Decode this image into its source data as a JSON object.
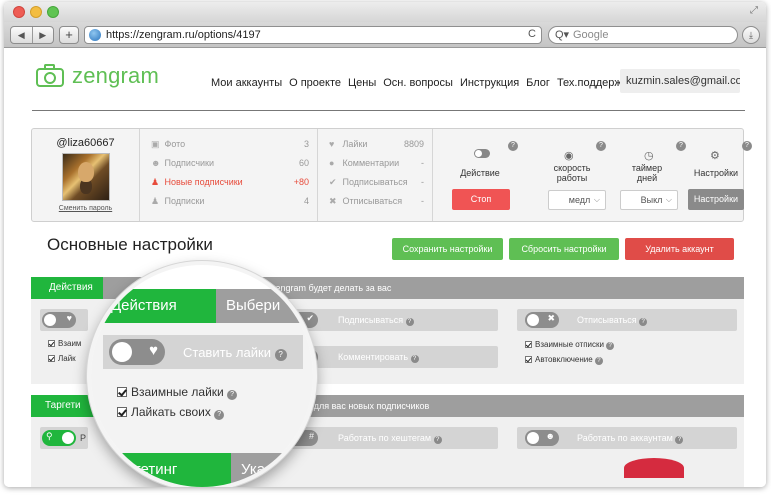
{
  "browser": {
    "url": "https://zengram.ru/options/4197",
    "search_placeholder": "Google",
    "nav_back": "◀",
    "nav_forward": "▶",
    "new_tab": "+",
    "reload": "C",
    "search_glyph": "Q▾",
    "download_glyph": "⤓",
    "fullscreen_glyph": "⤢"
  },
  "header": {
    "logo_text": "zengram",
    "nav": [
      "Мои аккаунты",
      "О проекте",
      "Цены",
      "Осн. вопросы",
      "Инструкция",
      "Блог",
      "Тех.поддержка"
    ],
    "email": "kuzmin.sales@gmail.com"
  },
  "account": {
    "username": "@liza60667",
    "change_password": "Сменить пароль"
  },
  "stats": {
    "col1": [
      {
        "icon": "▣",
        "label": "Фото",
        "value": "3"
      },
      {
        "icon": "☻",
        "label": "Подписчики",
        "value": "60"
      },
      {
        "icon": "♟",
        "label": "Новые подписчики",
        "value": "+80",
        "highlight": true
      },
      {
        "icon": "♟",
        "label": "Подписки",
        "value": "4"
      }
    ],
    "col2": [
      {
        "icon": "♥",
        "label": "Лайки",
        "value": "8809"
      },
      {
        "icon": "●",
        "label": "Комментарии",
        "value": "-"
      },
      {
        "icon": "✔",
        "label": "Подписываться",
        "value": "-"
      },
      {
        "icon": "✖",
        "label": "Отписываться",
        "value": "-"
      }
    ]
  },
  "controls": {
    "action_label": "Действие",
    "speed_label_1": "скорость",
    "speed_label_2": "работы",
    "timer_label_1": "таймер",
    "timer_label_2": "дней",
    "settings_label": "Настройки",
    "stop_button": "Стоп",
    "speed_value": "медл",
    "timer_value": "Выкл",
    "settings_button": "Настройки",
    "help": "?",
    "dropdown_glyph": "⌵",
    "speed_icon_glyph": "◉",
    "timer_icon_glyph": "◷",
    "settings_icon_glyph": "⚙"
  },
  "settings": {
    "title": "Основные настройки",
    "save_button": "Сохранить настройки",
    "reset_button": "Сбросить настройки",
    "delete_button": "Удалить аккаунт"
  },
  "actions_section": {
    "tab": "Действия",
    "description": "zengram будет делать за вас",
    "like_card": {
      "checkboxes": [
        "Взаим",
        "Лайк"
      ]
    },
    "follow_card": {
      "label": "Подписываться"
    },
    "comment_card": {
      "label": "Комментировать"
    },
    "unfollow_card": {
      "label": "Отписываться",
      "checkboxes": [
        "Взаимные отписки",
        "Автовключение"
      ]
    }
  },
  "targeting_section": {
    "tab": "Таргети",
    "description": "скать для вас новых подписчиков",
    "geo_card": {
      "label": "Р"
    },
    "hashtag_card": {
      "label": "Работать по хештегам"
    },
    "accounts_card": {
      "label": "Работать по аккаунтам"
    }
  },
  "magnifier": {
    "tab_active": "Действия",
    "tab_inactive": "Выбери",
    "card_label": "Ставить лайки",
    "checkbox_1": "Взаимные лайки",
    "checkbox_2": "Лайкать своих",
    "bottom_tab_active": "ргетинг",
    "bottom_tab_inactive": "Ука"
  },
  "colors": {
    "brand_green": "#20b63d",
    "button_green": "#5fbf54",
    "danger_red": "#e04c48",
    "stop_red": "#f05454",
    "section_gray": "#9e9e9e"
  }
}
